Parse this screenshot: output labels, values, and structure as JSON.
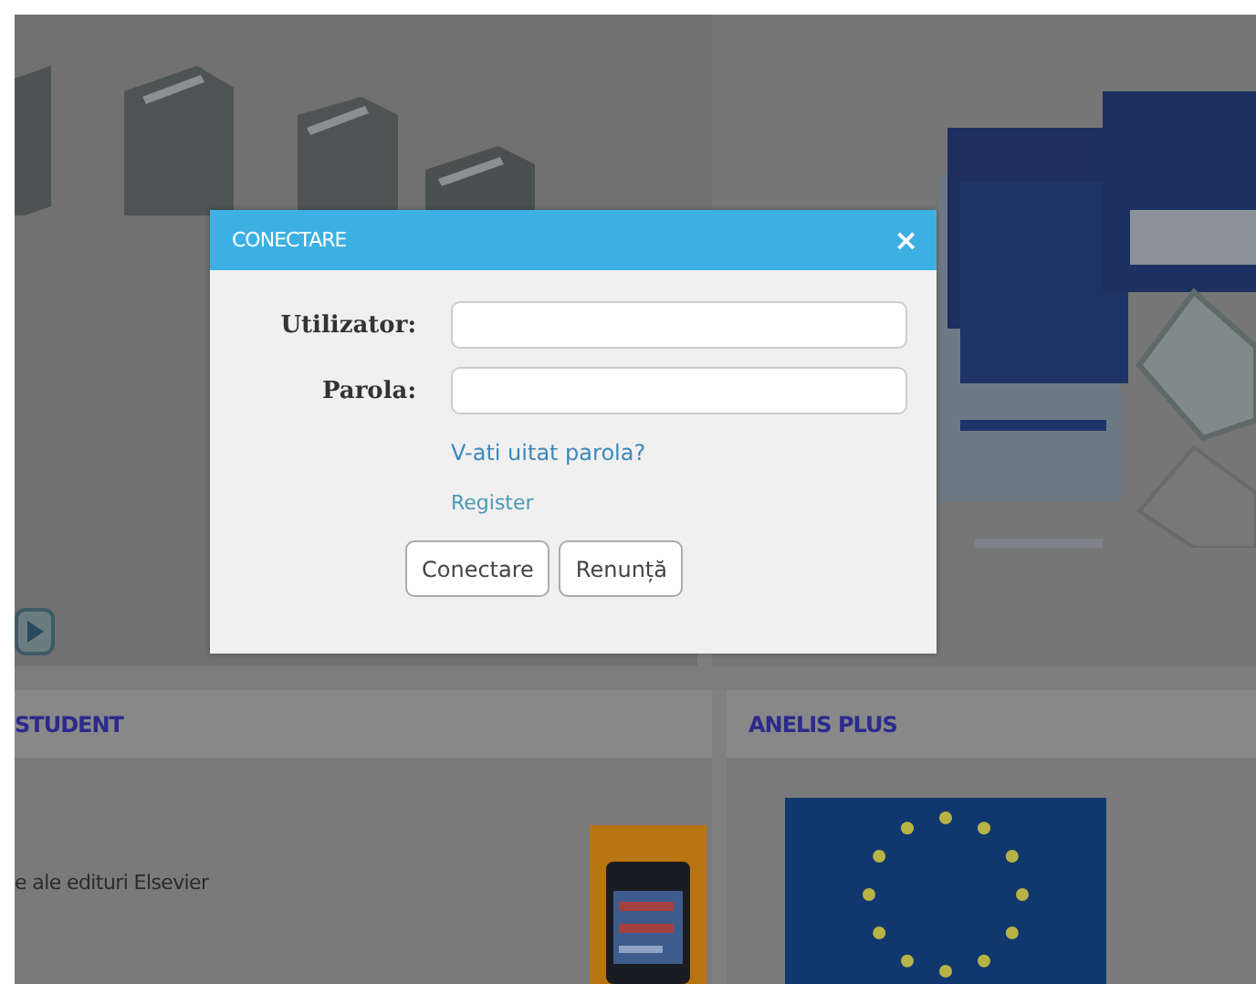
{
  "dialog": {
    "title": "CONECTARE",
    "close": "×",
    "fields": [
      {
        "label": "Utilizator:"
      },
      {
        "label": "Parola:"
      }
    ],
    "links": [
      "V-ati uitat parola?",
      "Register"
    ],
    "buttons": [
      "Conectare",
      "Renunță"
    ]
  },
  "sections": [
    {
      "title": "STUDENT",
      "text": "e ale edituri Elsevier"
    },
    {
      "title": "ANELIS PLUS"
    }
  ]
}
